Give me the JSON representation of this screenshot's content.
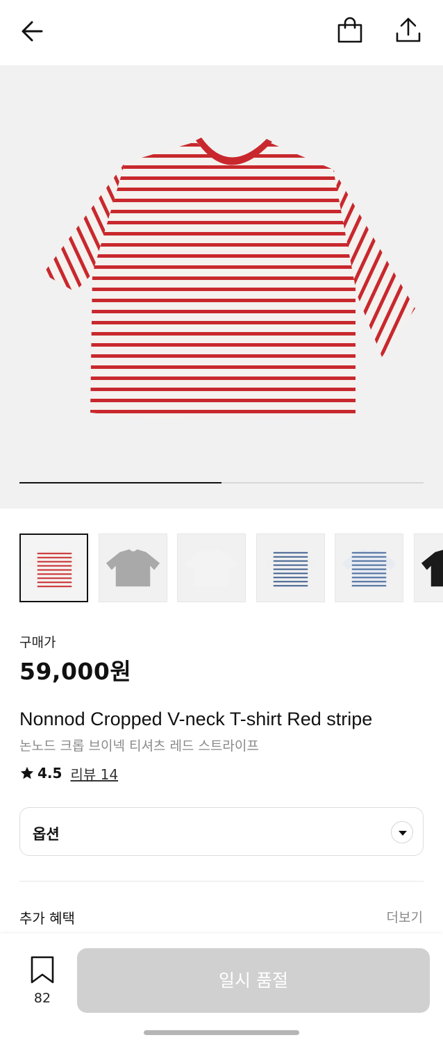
{
  "header": {
    "back_icon": "arrow-left-icon",
    "bag_icon": "shopping-bag-icon",
    "share_icon": "share-upload-icon"
  },
  "gallery": {
    "image_progress": 0.5,
    "thumbnails": [
      {
        "label": "red stripe",
        "colors": [
          "#f4f1ee",
          "#c8282d"
        ]
      },
      {
        "label": "gray",
        "colors": [
          "#a9a9a9"
        ]
      },
      {
        "label": "white",
        "colors": [
          "#f3f3f3"
        ]
      },
      {
        "label": "navy stripe",
        "colors": [
          "#f0f0f0",
          "#3f5f8f"
        ]
      },
      {
        "label": "blue stripe",
        "colors": [
          "#e7ebf2",
          "#4a6b9c"
        ]
      },
      {
        "label": "black",
        "colors": [
          "#1a1a1a"
        ]
      }
    ]
  },
  "product": {
    "price_label": "구매가",
    "price": "59,000원",
    "name_en": "Nonnod Cropped V-neck T-shirt Red stripe",
    "name_ko": "논노드 크롭 브이넥 티셔츠 레드 스트라이프",
    "rating": "4.5",
    "review_link": "리뷰 14"
  },
  "options": {
    "label": "옵션"
  },
  "benefits": {
    "title": "추가 혜택",
    "more": "더보기"
  },
  "bottom": {
    "wish_count": "82",
    "soldout_label": "일시 품절"
  },
  "colors": {
    "stripe_red": "#c8282d",
    "button_disabled": "#d0d0d0"
  }
}
